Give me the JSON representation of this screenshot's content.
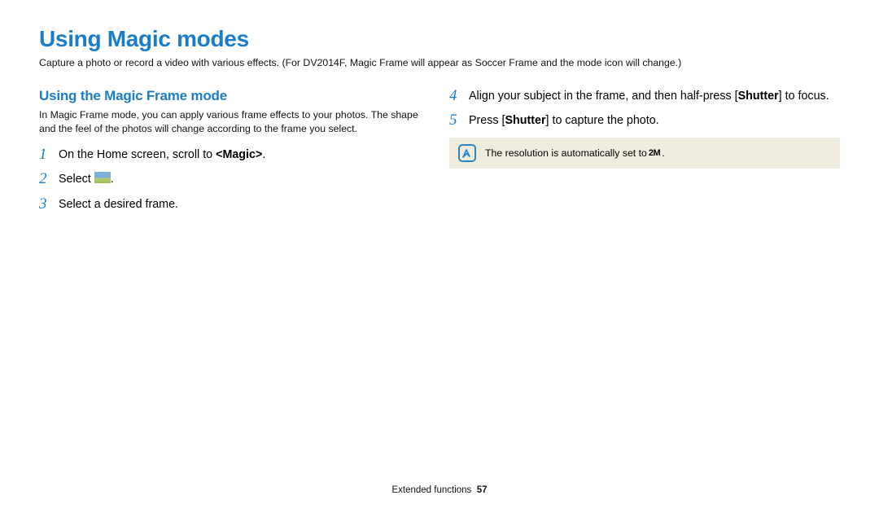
{
  "title": "Using Magic modes",
  "subtitle": "Capture a photo or record a video with various effects. (For DV2014F, Magic Frame will appear as Soccer Frame and the mode icon will change.)",
  "left": {
    "sectionTitle": "Using the Magic Frame mode",
    "intro": "In Magic Frame mode, you can apply various frame effects to your photos. The shape and the feel of the photos will change according to the frame you select.",
    "steps": {
      "s1": {
        "num": "1",
        "prefix": "On the Home screen, scroll to ",
        "bold": "<Magic>",
        "suffix": "."
      },
      "s2": {
        "num": "2",
        "prefix": "Select ",
        "suffix": "."
      },
      "s3": {
        "num": "3",
        "text": "Select a desired frame."
      }
    }
  },
  "right": {
    "steps": {
      "s4": {
        "num": "4",
        "prefix": "Align your subject in the frame, and then half-press [",
        "bold": "Shutter",
        "suffix": "] to focus."
      },
      "s5": {
        "num": "5",
        "prefix": "Press [",
        "bold": "Shutter",
        "suffix": "] to capture the photo."
      }
    },
    "note": {
      "text": "The resolution is automatically set to ",
      "res": "2M",
      "suffix": "."
    }
  },
  "footer": {
    "section": "Extended functions",
    "page": "57"
  }
}
